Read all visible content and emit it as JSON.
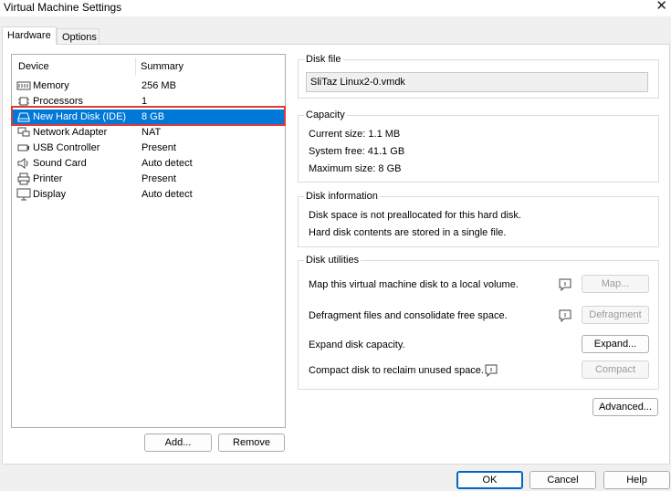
{
  "window": {
    "title": "Virtual Machine Settings"
  },
  "tabs": [
    {
      "label": "Hardware"
    },
    {
      "label": "Options"
    }
  ],
  "devices": {
    "headers": {
      "device": "Device",
      "summary": "Summary"
    },
    "rows": [
      {
        "name": "Memory",
        "summary": "256 MB",
        "icon": "memory-icon"
      },
      {
        "name": "Processors",
        "summary": "1",
        "icon": "processor-icon"
      },
      {
        "name": "New Hard Disk (IDE)",
        "summary": "8 GB",
        "icon": "hard-disk-icon"
      },
      {
        "name": "Network Adapter",
        "summary": "NAT",
        "icon": "network-icon"
      },
      {
        "name": "USB Controller",
        "summary": "Present",
        "icon": "usb-icon"
      },
      {
        "name": "Sound Card",
        "summary": "Auto detect",
        "icon": "sound-icon"
      },
      {
        "name": "Printer",
        "summary": "Present",
        "icon": "printer-icon"
      },
      {
        "name": "Display",
        "summary": "Auto detect",
        "icon": "display-icon"
      }
    ],
    "add_label": "Add...",
    "remove_label": "Remove"
  },
  "disk_file": {
    "title": "Disk file",
    "value": "SliTaz Linux2-0.vmdk"
  },
  "capacity": {
    "title": "Capacity",
    "current": "Current size:  1.1 MB",
    "free": "System free:  41.1 GB",
    "max": "Maximum size:  8 GB"
  },
  "disk_info": {
    "title": "Disk information",
    "line1": "Disk space is not preallocated for this hard disk.",
    "line2": "Hard disk contents are stored in a single file."
  },
  "utilities": {
    "title": "Disk utilities",
    "map_text": "Map this virtual machine disk to a local volume.",
    "map_btn": "Map...",
    "defrag_text": "Defragment files and consolidate free space.",
    "defrag_btn": "Defragment",
    "expand_text": "Expand disk capacity.",
    "expand_btn": "Expand...",
    "compact_text": "Compact disk to reclaim unused space.",
    "compact_btn": "Compact"
  },
  "advanced_label": "Advanced...",
  "footer": {
    "ok": "OK",
    "cancel": "Cancel",
    "help": "Help"
  },
  "colors": {
    "selection": "#0078d7",
    "highlight_border": "#e53935",
    "default_button_border": "#0067c0"
  }
}
